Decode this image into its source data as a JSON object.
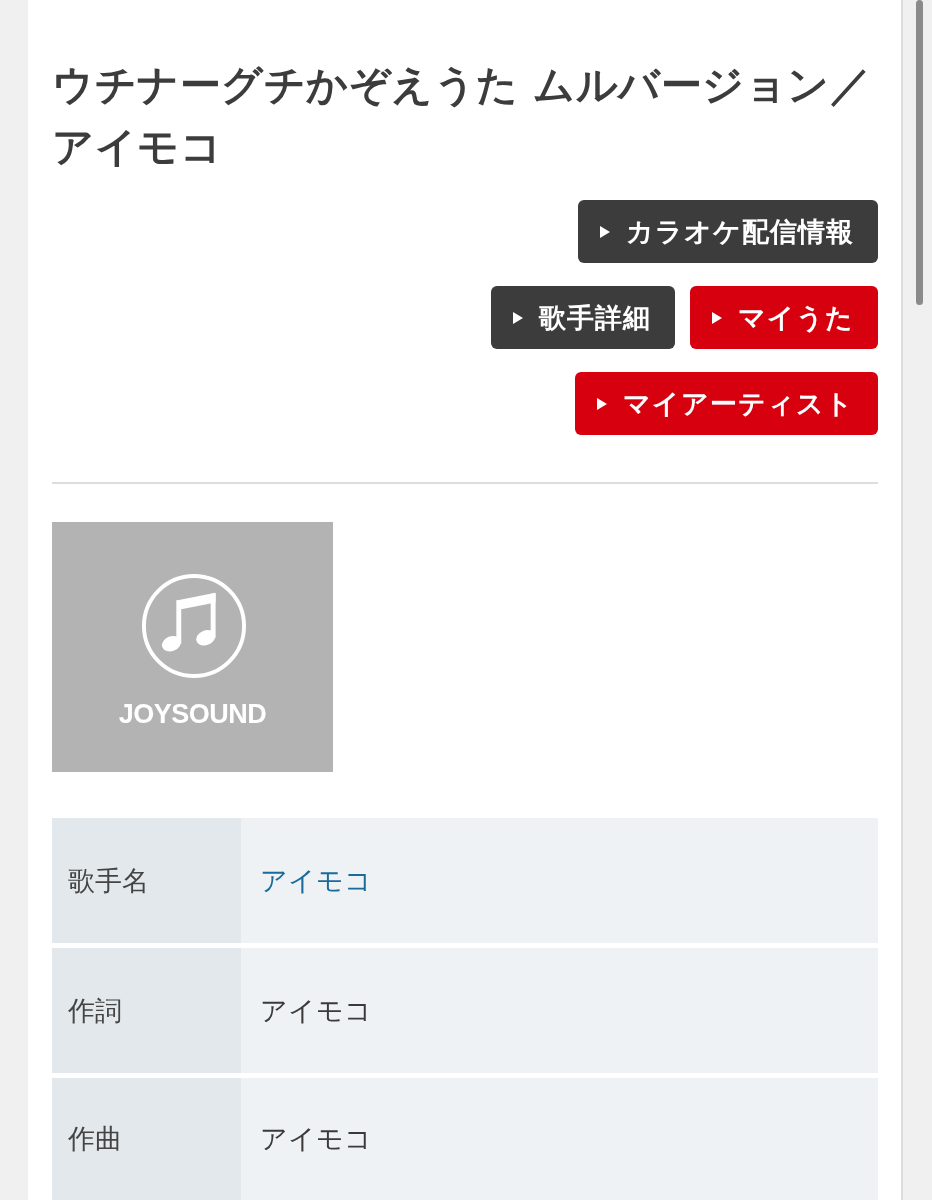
{
  "title": "ウチナーグチかぞえうた ムルバージョン／アイモコ",
  "actions": [
    {
      "label": "カラオケ配信情報",
      "color": "#3c3c3c"
    },
    {
      "label": "歌手詳細",
      "color": "#3c3c3c"
    },
    {
      "label": "マイうた",
      "color": "#d7000f"
    },
    {
      "label": "マイアーティスト",
      "color": "#d7000f"
    }
  ],
  "cover_image": {
    "logo_text": "JOYSOUND"
  },
  "details": {
    "rows": [
      {
        "label": "歌手名",
        "value": "アイモコ",
        "kind": "link"
      },
      {
        "label": "作詞",
        "value": "アイモコ",
        "kind": "text"
      },
      {
        "label": "作曲",
        "value": "アイモコ",
        "kind": "text"
      }
    ]
  }
}
